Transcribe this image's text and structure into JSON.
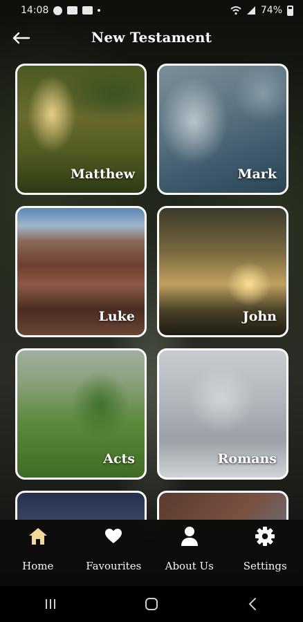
{
  "status_bar": {
    "time": "14:08",
    "battery_text": "74%"
  },
  "header": {
    "title": "New Testament",
    "back_icon": "arrow-left-icon"
  },
  "books": [
    {
      "name": "Matthew"
    },
    {
      "name": "Mark"
    },
    {
      "name": "Luke"
    },
    {
      "name": "John"
    },
    {
      "name": "Acts"
    },
    {
      "name": "Romans"
    }
  ],
  "bottom_nav": {
    "items": [
      {
        "label": "Home",
        "icon": "home-icon",
        "color": "#f2d79a"
      },
      {
        "label": "Favourites",
        "icon": "heart-icon",
        "color": "#ffffff"
      },
      {
        "label": "About Us",
        "icon": "person-icon",
        "color": "#ffffff"
      },
      {
        "label": "Settings",
        "icon": "gear-icon",
        "color": "#ffffff"
      }
    ]
  },
  "system_nav": {
    "icons": [
      "recents-icon",
      "home-circle-icon",
      "back-chevron-icon"
    ]
  }
}
